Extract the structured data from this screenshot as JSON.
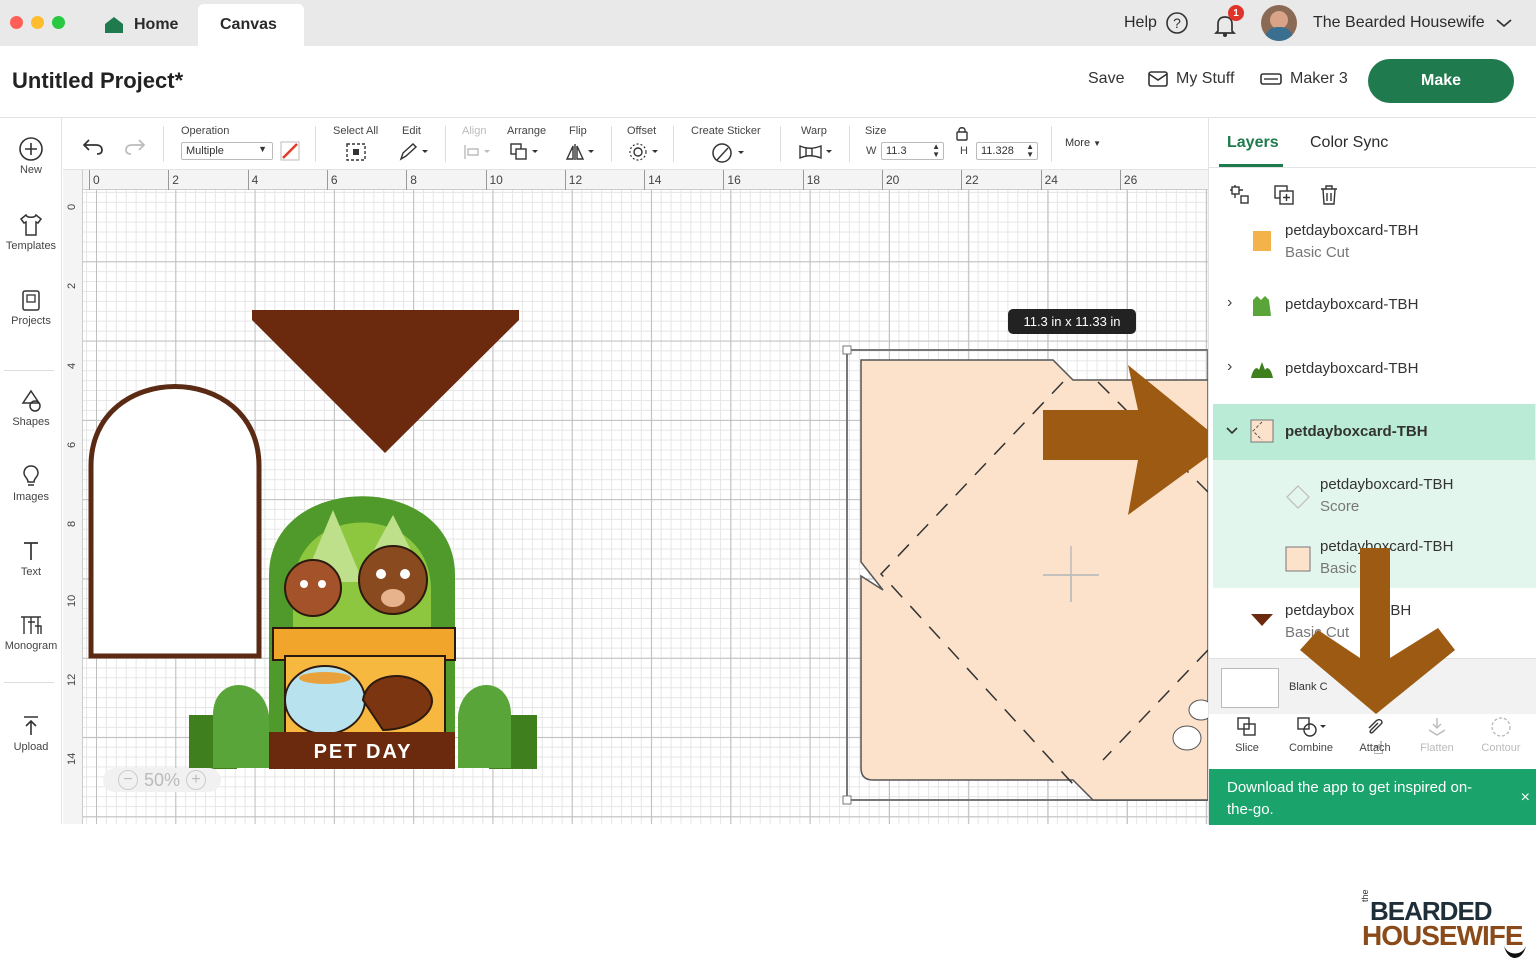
{
  "tabs": {
    "home": "Home",
    "canvas": "Canvas"
  },
  "top_right": {
    "help": "Help",
    "notification_count": "1",
    "user_name": "The Bearded Housewife"
  },
  "project": {
    "title": "Untitled Project*",
    "save": "Save",
    "my_stuff": "My Stuff",
    "machine": "Maker 3",
    "make": "Make"
  },
  "sidebar": {
    "items": [
      {
        "label": "New",
        "icon": "plus-circle-icon"
      },
      {
        "label": "Templates",
        "icon": "shirt-icon"
      },
      {
        "label": "Projects",
        "icon": "projects-icon"
      },
      {
        "label": "Shapes",
        "icon": "shapes-icon"
      },
      {
        "label": "Images",
        "icon": "lightbulb-icon"
      },
      {
        "label": "Text",
        "icon": "text-icon"
      },
      {
        "label": "Monogram",
        "icon": "monogram-icon"
      },
      {
        "label": "Upload",
        "icon": "upload-icon"
      }
    ]
  },
  "toolbar": {
    "operation": "Operation",
    "operation_value": "Multiple",
    "select_all": "Select All",
    "edit": "Edit",
    "align": "Align",
    "arrange": "Arrange",
    "flip": "Flip",
    "offset": "Offset",
    "create_sticker": "Create Sticker",
    "warp": "Warp",
    "size": "Size",
    "w_label": "W",
    "w_value": "11.3",
    "h_label": "H",
    "h_value": "11.328",
    "more": "More"
  },
  "rulers": {
    "top": [
      "0",
      "2",
      "4",
      "6",
      "8",
      "10",
      "12",
      "14",
      "16",
      "18",
      "20",
      "22",
      "24",
      "26"
    ],
    "left": [
      "0",
      "2",
      "4",
      "6",
      "8",
      "10",
      "12",
      "14"
    ]
  },
  "canvas": {
    "dimension_tip": "11.3  in x 11.33  in",
    "zoom": "50%",
    "pet_day_text": "PET DAY"
  },
  "panel": {
    "tab_layers": "Layers",
    "tab_color_sync": "Color Sync",
    "layers": [
      {
        "name": "petdayboxcard-TBH",
        "sub": "Basic Cut"
      },
      {
        "name": "petdayboxcard-TBH",
        "sub": ""
      },
      {
        "name": "petdayboxcard-TBH",
        "sub": ""
      },
      {
        "name": "petdayboxcard-TBH",
        "sub": "",
        "selected": true
      },
      {
        "name": "petdayboxcard-TBH",
        "sub": "Score"
      },
      {
        "name": "petdayboxcard-TBH",
        "sub": "Basic"
      },
      {
        "name": "petdaybox",
        "name_end": "-TBH",
        "sub": "Basic Cut"
      }
    ],
    "blank_canvas": "Blank C",
    "bottom_tools": [
      "Slice",
      "Combine",
      "Attach",
      "Flatten",
      "Contour"
    ]
  },
  "banner": {
    "text": "Download the app to get inspired on-the-go."
  },
  "logo": {
    "line1": "BEARDED",
    "line2": "HOUSEWIFE",
    "small": "the"
  },
  "colors": {
    "brand_green": "#1f7a4d",
    "banner_green": "#1aa36a",
    "arrow_brown": "#9c5a12",
    "selected_row": "#c9efe1"
  }
}
